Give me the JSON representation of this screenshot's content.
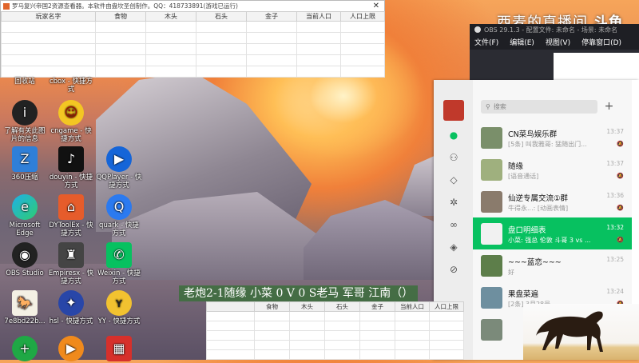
{
  "game_window": {
    "title": "罗马复兴帝国2资源查看器。本软件由盘坎圣创制作。QQ：418733891(游戏已运行)",
    "columns": [
      "玩家名字",
      "食物",
      "木头",
      "石头",
      "金子",
      "当前人口",
      "人口上限"
    ],
    "close": "✕"
  },
  "stream": {
    "title": "西麦的直播间",
    "brand": "斗鱼"
  },
  "desktop_icons": [
    {
      "label": "回收站",
      "glyph": "🗑"
    },
    {
      "label": "cbox - 快捷方式",
      "glyph": "C"
    },
    {
      "label": "了解有关此图片的信息",
      "glyph": "i"
    },
    {
      "label": "cngame - 快捷方式",
      "glyph": "☺"
    },
    {
      "label": "360压缩",
      "glyph": "Z"
    },
    {
      "label": "douyin - 快捷方式",
      "glyph": "♪"
    },
    {
      "label": "QQPlayer - 快捷方式",
      "glyph": "▶"
    },
    {
      "label": "Microsoft Edge",
      "glyph": "e"
    },
    {
      "label": "DYToolEx - 快捷方式",
      "glyph": "⌂"
    },
    {
      "label": "quark - 快捷方式",
      "glyph": "Q"
    },
    {
      "label": "OBS Studio",
      "glyph": "◉"
    },
    {
      "label": "Empiresx - 快捷方式",
      "glyph": "♜"
    },
    {
      "label": "Weixin - 快捷方式",
      "glyph": "✆"
    },
    {
      "label": "7e8bd22b...",
      "glyph": "🐎"
    },
    {
      "label": "hsl - 快捷方式",
      "glyph": "✦"
    },
    {
      "label": "YY - 快捷方式",
      "glyph": "ʏ"
    },
    {
      "label": "",
      "glyph": "+"
    },
    {
      "label": "",
      "glyph": "▶"
    },
    {
      "label": "",
      "glyph": "▦"
    }
  ],
  "obs": {
    "title": "OBS 29.1.3 - 配置文件: 未命名 - 场景: 未命名",
    "menu": [
      "文件(F)",
      "编辑(E)",
      "视图(V)",
      "停靠窗口(D)"
    ]
  },
  "wechat": {
    "search_placeholder": "搜索",
    "plus": "+",
    "chats": [
      {
        "name": "CN菜鸟娱乐群",
        "preview": "[5条] 叫我雅哥: 猛随出门...",
        "time": "13:37",
        "selected": false
      },
      {
        "name": "随缘",
        "preview": "[语音通话]",
        "time": "13:37",
        "selected": false
      },
      {
        "name": "仙逆专属交流①群",
        "preview": "牛得永...: [动画表情]",
        "time": "13:36",
        "selected": false
      },
      {
        "name": "盘口明细表",
        "preview": "小菜: 强总 伦敦 斗哥 3 vs ...",
        "time": "13:32",
        "selected": true
      },
      {
        "name": "~~~蓝恋~~~",
        "preview": "好",
        "time": "13:25",
        "selected": false
      },
      {
        "name": "果盘菜遍",
        "preview": "[2条] 3月28号...",
        "time": "13:24",
        "selected": false
      }
    ]
  },
  "banner": {
    "text": "老炮2-1随缘  小菜 0 V 0 S老马  军哥   江南（）"
  },
  "sheet": {
    "columns": [
      "",
      "食物",
      "木头",
      "石头",
      "金子",
      "当前人口",
      "人口上限"
    ]
  }
}
